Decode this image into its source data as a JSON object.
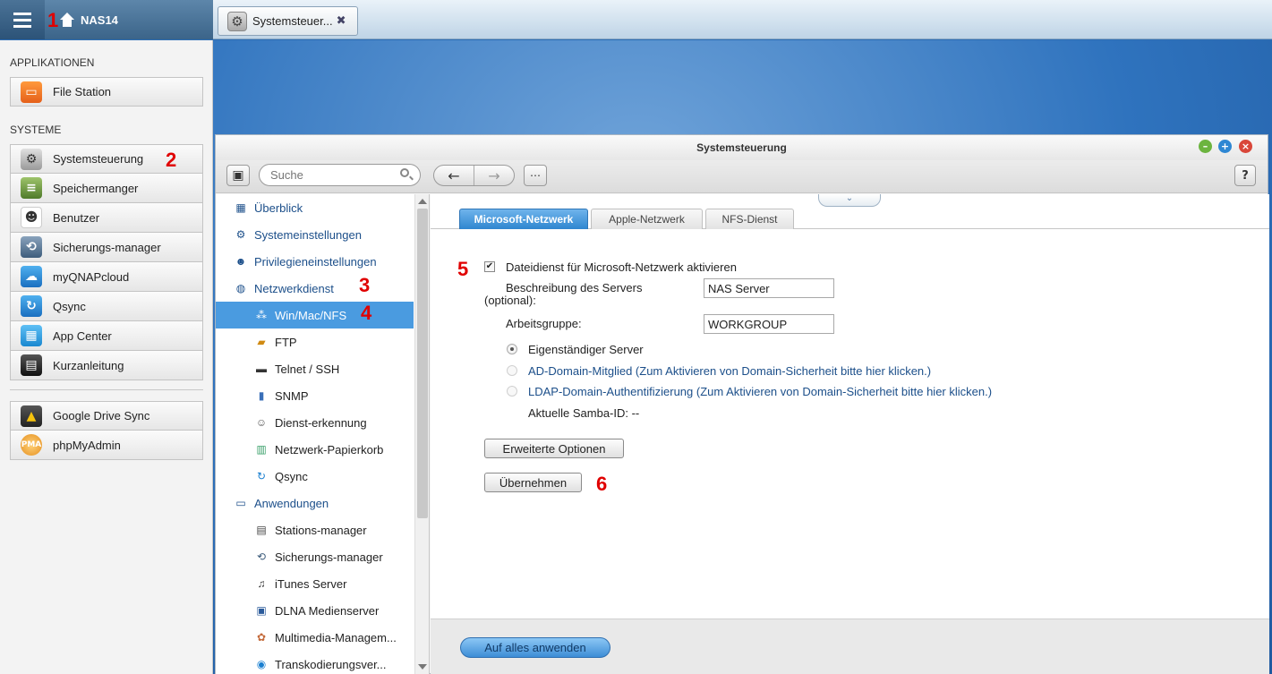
{
  "topbar": {
    "nas_name": "NAS14",
    "taskbar_tab_label": "Systemsteuer...",
    "taskbar_tab_close": "✖"
  },
  "annotations": [
    "1",
    "2",
    "3",
    "4",
    "5",
    "6"
  ],
  "sidemenu": {
    "section_apps": "APPLIKATIONEN",
    "apps": [
      {
        "label": "File Station",
        "icon": "folder-icon"
      }
    ],
    "section_systems": "SYSTEME",
    "systems": [
      {
        "label": "Systemsteuerung",
        "icon": "gear-icon"
      },
      {
        "label": "Speichermanger",
        "icon": "storage-icon"
      },
      {
        "label": "Benutzer",
        "icon": "user-icon"
      },
      {
        "label": "Sicherungs-manager",
        "icon": "backup-icon"
      },
      {
        "label": "myQNAPcloud",
        "icon": "cloud-icon"
      },
      {
        "label": "Qsync",
        "icon": "sync-icon"
      },
      {
        "label": "App Center",
        "icon": "grid-icon"
      },
      {
        "label": "Kurzanleitung",
        "icon": "guide-icon"
      }
    ],
    "extras": [
      {
        "label": "Google Drive Sync",
        "icon": "drive-icon"
      },
      {
        "label": "phpMyAdmin",
        "icon": "pma-icon"
      }
    ]
  },
  "window": {
    "title": "Systemsteuerung",
    "search_placeholder": "Suche",
    "help_label": "?",
    "tree": [
      {
        "label": "Überblick",
        "level": "top",
        "icon": "overview-icon"
      },
      {
        "label": "Systemeinstellungen",
        "level": "top",
        "icon": "gear-icon"
      },
      {
        "label": "Privilegieneinstellungen",
        "level": "top",
        "icon": "user-icon"
      },
      {
        "label": "Netzwerkdienst",
        "level": "top",
        "icon": "globe-icon"
      },
      {
        "label": "Win/Mac/NFS",
        "level": "sub",
        "icon": "network-icon",
        "active": true
      },
      {
        "label": "FTP",
        "level": "sub",
        "icon": "ftp-icon"
      },
      {
        "label": "Telnet / SSH",
        "level": "sub",
        "icon": "terminal-icon"
      },
      {
        "label": "SNMP",
        "level": "sub",
        "icon": "chart-icon"
      },
      {
        "label": "Dienst-erkennung",
        "level": "sub",
        "icon": "robot-icon"
      },
      {
        "label": "Netzwerk-Papierkorb",
        "level": "sub",
        "icon": "trash-icon"
      },
      {
        "label": "Qsync",
        "level": "sub",
        "icon": "sync-icon"
      },
      {
        "label": "Anwendungen",
        "level": "top",
        "icon": "apps-icon"
      },
      {
        "label": "Stations-manager",
        "level": "sub",
        "icon": "station-icon"
      },
      {
        "label": "Sicherungs-manager",
        "level": "sub",
        "icon": "backup-icon"
      },
      {
        "label": "iTunes Server",
        "level": "sub",
        "icon": "itunes-icon"
      },
      {
        "label": "DLNA Medienserver",
        "level": "sub",
        "icon": "dlna-icon"
      },
      {
        "label": "Multimedia-Managem...",
        "level": "sub",
        "icon": "multimedia-icon"
      },
      {
        "label": "Transkodierungsver...",
        "level": "sub",
        "icon": "transcode-icon"
      }
    ],
    "tabs": [
      "Microsoft-Netzwerk",
      "Apple-Netzwerk",
      "NFS-Dienst"
    ],
    "form": {
      "enable_label": "Dateidienst für Microsoft-Netzwerk aktivieren",
      "enable_checked": "✔",
      "desc_label_1": "Beschreibung des Servers",
      "desc_label_2": "(optional):",
      "desc_value": "NAS Server",
      "workgroup_label": "Arbeitsgruppe:",
      "workgroup_value": "WORKGROUP",
      "radio_standalone": "Eigenständiger Server",
      "radio_ad": "AD-Domain-Mitglied (Zum Aktivieren von Domain-Sicherheit bitte hier klicken.)",
      "radio_ldap": "LDAP-Domain-Authentifizierung (Zum Aktivieren von Domain-Sicherheit bitte hier klicken.)",
      "samba_id": "Aktuelle Samba-ID: --",
      "advanced_button": "Erweiterte Optionen",
      "apply_button": "Übernehmen"
    },
    "footer_apply_all": "Auf alles anwenden"
  }
}
